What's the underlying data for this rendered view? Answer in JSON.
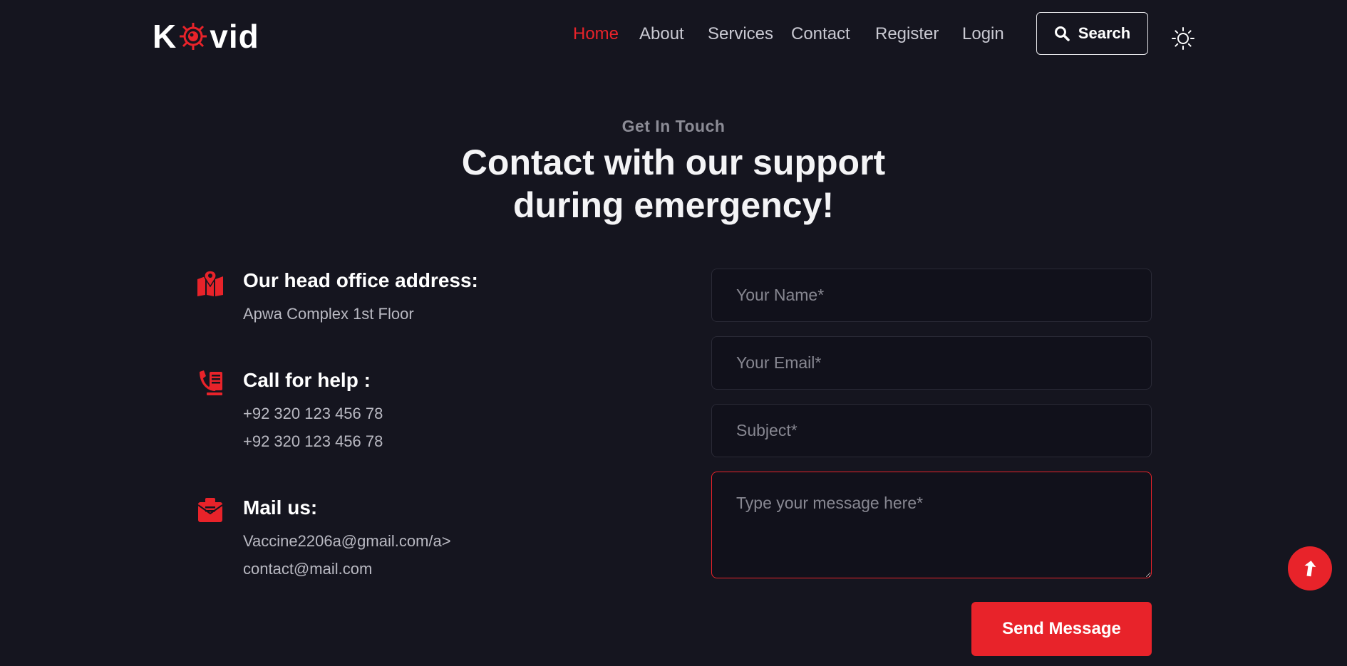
{
  "header": {
    "logo": {
      "prefix": "K",
      "suffix": "vid"
    },
    "nav": [
      {
        "label": "Home",
        "active": true
      },
      {
        "label": "About",
        "active": false
      },
      {
        "label": "Services",
        "active": false
      },
      {
        "label": "Contact",
        "active": false
      },
      {
        "label": "Register",
        "active": false
      },
      {
        "label": "Login",
        "active": false
      }
    ],
    "search_label": "Search",
    "theme_icon": "sun-icon"
  },
  "hero": {
    "eyebrow": "Get In Touch",
    "title_line1": "Contact with our support",
    "title_line2": "during emergency!"
  },
  "info": {
    "address": {
      "icon": "map-pin-icon",
      "heading": "Our head office address:",
      "lines": [
        "Apwa Complex 1st Floor"
      ]
    },
    "phone": {
      "icon": "phone-icon",
      "heading": "Call for help :",
      "lines": [
        "+92 320 123 456 78",
        "+92 320 123 456 78"
      ]
    },
    "mail": {
      "icon": "mail-icon",
      "heading": "Mail us:",
      "lines": [
        "Vaccine2206a@gmail.com/a>",
        "contact@mail.com"
      ]
    }
  },
  "form": {
    "name_placeholder": "Your Name*",
    "email_placeholder": "Your Email*",
    "subject_placeholder": "Subject*",
    "message_placeholder": "Type your message here*",
    "submit_label": "Send Message"
  },
  "colors": {
    "accent": "#e8232a",
    "background": "#15151f",
    "field_bg": "#11111b"
  }
}
